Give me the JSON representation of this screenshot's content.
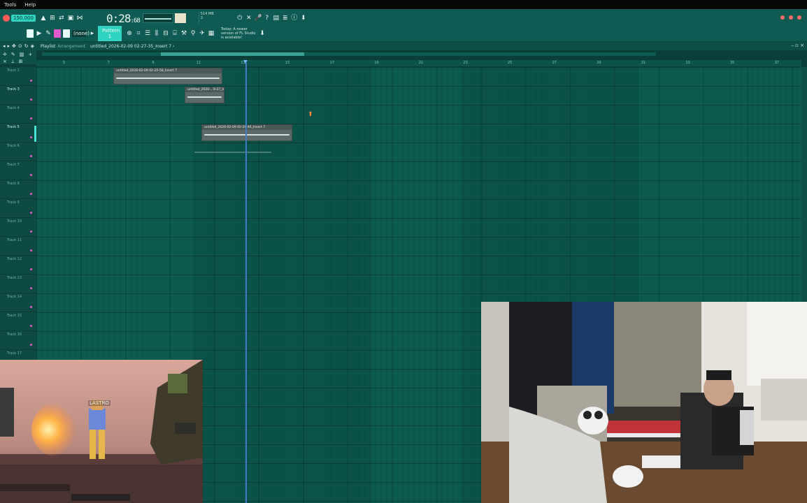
{
  "menu": {
    "tools": "Tools",
    "help": "Help"
  },
  "toolbar": {
    "tempo": "150.000",
    "time_main": "0:28",
    "time_sub": ":68",
    "cpu_mem": "514 MB",
    "cpu_val": "2",
    "pattern_none": "(none)",
    "pattern_name": "Pattern 1",
    "newer_version": "Today: A newer version of FL Studio is available!"
  },
  "playlist": {
    "title": "Playlist",
    "subtitle": "Arrangement",
    "breadcrumb": "untitled_2026-02-09 02-27-35_Insert 7 ›"
  },
  "ruler": {
    "ticks": [
      "5",
      "7",
      "9",
      "11",
      "13",
      "15",
      "17",
      "19",
      "21",
      "23",
      "25",
      "27",
      "29",
      "31",
      "33",
      "35",
      "37"
    ]
  },
  "tracks": [
    {
      "name": "Track 2"
    },
    {
      "name": "Track 3"
    },
    {
      "name": "Track 4"
    },
    {
      "name": "Track 5"
    },
    {
      "name": "Track 6"
    },
    {
      "name": "Track 7"
    },
    {
      "name": "Track 8"
    },
    {
      "name": "Track 9"
    },
    {
      "name": "Track 10"
    },
    {
      "name": "Track 11"
    },
    {
      "name": "Track 12"
    },
    {
      "name": "Track 13"
    },
    {
      "name": "Track 14"
    },
    {
      "name": "Track 15"
    },
    {
      "name": "Track 16"
    },
    {
      "name": "Track 17"
    }
  ],
  "clips": [
    {
      "label": "untitled_2026-02-09 02-25-58_Insert 7"
    },
    {
      "label": "untitled_2026-...9-27_Insert 7"
    },
    {
      "label": "untitled_2026-02-09 02-26-46_Insert 7"
    }
  ],
  "game": {
    "player_tag": "LASTRO"
  }
}
